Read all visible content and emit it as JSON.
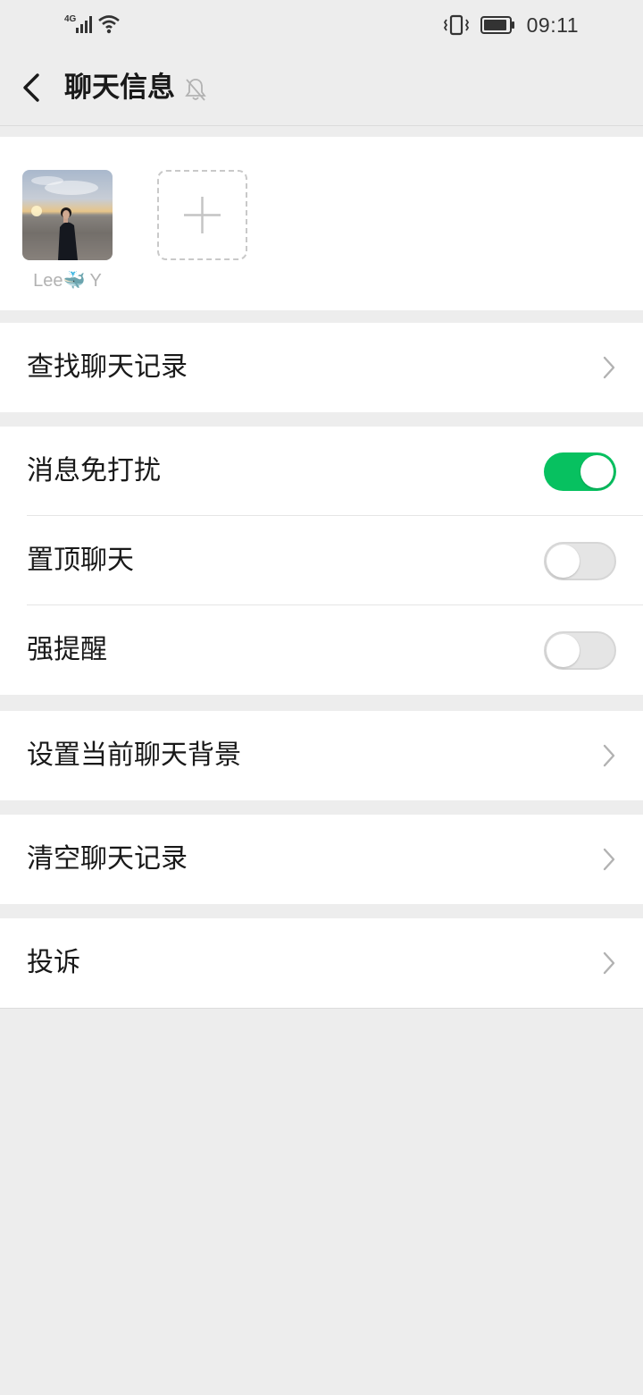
{
  "status_bar": {
    "network": "4G",
    "time": "09:11",
    "icons": [
      "signal-icon",
      "wifi-icon",
      "vibrate-icon",
      "battery-icon"
    ]
  },
  "header": {
    "title": "聊天信息",
    "back_icon": "chevron-left-icon",
    "mute_icon": "bell-off-icon"
  },
  "members": {
    "items": [
      {
        "name": "Lee🐳 Y"
      }
    ],
    "add_icon": "plus-icon"
  },
  "section_search": {
    "search_history": "查找聊天记录"
  },
  "section_settings": {
    "mute_notifications": {
      "label": "消息免打扰",
      "state": "on"
    },
    "sticky_on_top": {
      "label": "置顶聊天",
      "state": "off"
    },
    "strong_reminder": {
      "label": "强提醒",
      "state": "off"
    }
  },
  "section_background": {
    "set_background": "设置当前聊天背景"
  },
  "section_clear": {
    "clear_history": "清空聊天记录"
  },
  "section_report": {
    "report": "投诉"
  },
  "colors": {
    "accent": "#07c160",
    "background": "#ededed",
    "card": "#ffffff"
  }
}
